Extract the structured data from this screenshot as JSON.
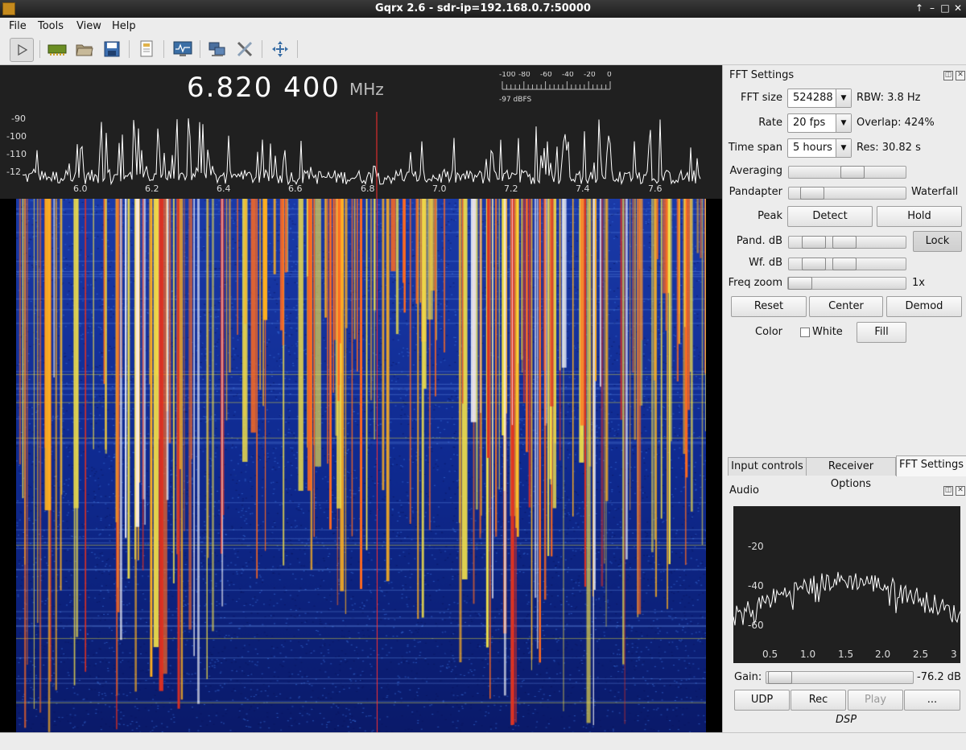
{
  "window": {
    "title": "Gqrx 2.6 - sdr-ip=192.168.0.7:50000",
    "controls": [
      "↑",
      "–",
      "□",
      "✕"
    ]
  },
  "menu": [
    "File",
    "Tools",
    "View",
    "Help"
  ],
  "toolbar": {
    "icons": [
      "play-icon",
      "sdr-device-icon",
      "open-folder-icon",
      "save-icon",
      "document-icon",
      "monitor-icon",
      "network-icon",
      "tools-icon",
      "fullscreen-icon"
    ]
  },
  "spectrum": {
    "frequency": "6.820 400",
    "unit": "MHz",
    "meter": {
      "ticks": [
        "-100",
        "-80",
        "-60",
        "-40",
        "-20",
        "0"
      ],
      "reading": "-97 dBFS"
    },
    "db_ticks": [
      "-90",
      "-100",
      "-110",
      "-12"
    ],
    "freq_ticks": [
      "6.0",
      "6.2",
      "6.4",
      "6.6",
      "6.8",
      "7.0",
      "7.2",
      "7.4",
      "7.6"
    ]
  },
  "fft_settings": {
    "title": "FFT Settings",
    "fft_size": {
      "label": "FFT size",
      "value": "524288",
      "info": "RBW: 3.8 Hz"
    },
    "rate": {
      "label": "Rate",
      "value": "20 fps",
      "info": "Overlap: 424%"
    },
    "time_span": {
      "label": "Time span",
      "value": "5 hours",
      "info": "Res: 30.82 s"
    },
    "averaging": {
      "label": "Averaging"
    },
    "pandapter": {
      "label": "Pandapter",
      "right_label": "Waterfall"
    },
    "peak": {
      "label": "Peak",
      "detect": "Detect",
      "hold": "Hold"
    },
    "pand_db": {
      "label": "Pand. dB",
      "lock": "Lock"
    },
    "wf_db": {
      "label": "Wf. dB"
    },
    "freq_zoom": {
      "label": "Freq zoom",
      "value": "1x"
    },
    "buttons": {
      "reset": "Reset",
      "center": "Center",
      "demod": "Demod"
    },
    "color": {
      "label": "Color",
      "white": "White",
      "fill": "Fill"
    }
  },
  "tabs": [
    "Input controls",
    "Receiver Options",
    "FFT Settings"
  ],
  "audio": {
    "title": "Audio",
    "y_ticks": [
      "-20",
      "-40",
      "-60"
    ],
    "x_ticks": [
      "0.5",
      "1.0",
      "1.5",
      "2.0",
      "2.5",
      "3"
    ],
    "gain_label": "Gain:",
    "gain_value": "-76.2 dB",
    "buttons": [
      "UDP",
      "Rec",
      "Play",
      "..."
    ],
    "dsp": "DSP"
  },
  "colors": {
    "waterfall_bg": "#0a1a6a",
    "trace": "#ffffff",
    "marker": "#ff3030"
  }
}
